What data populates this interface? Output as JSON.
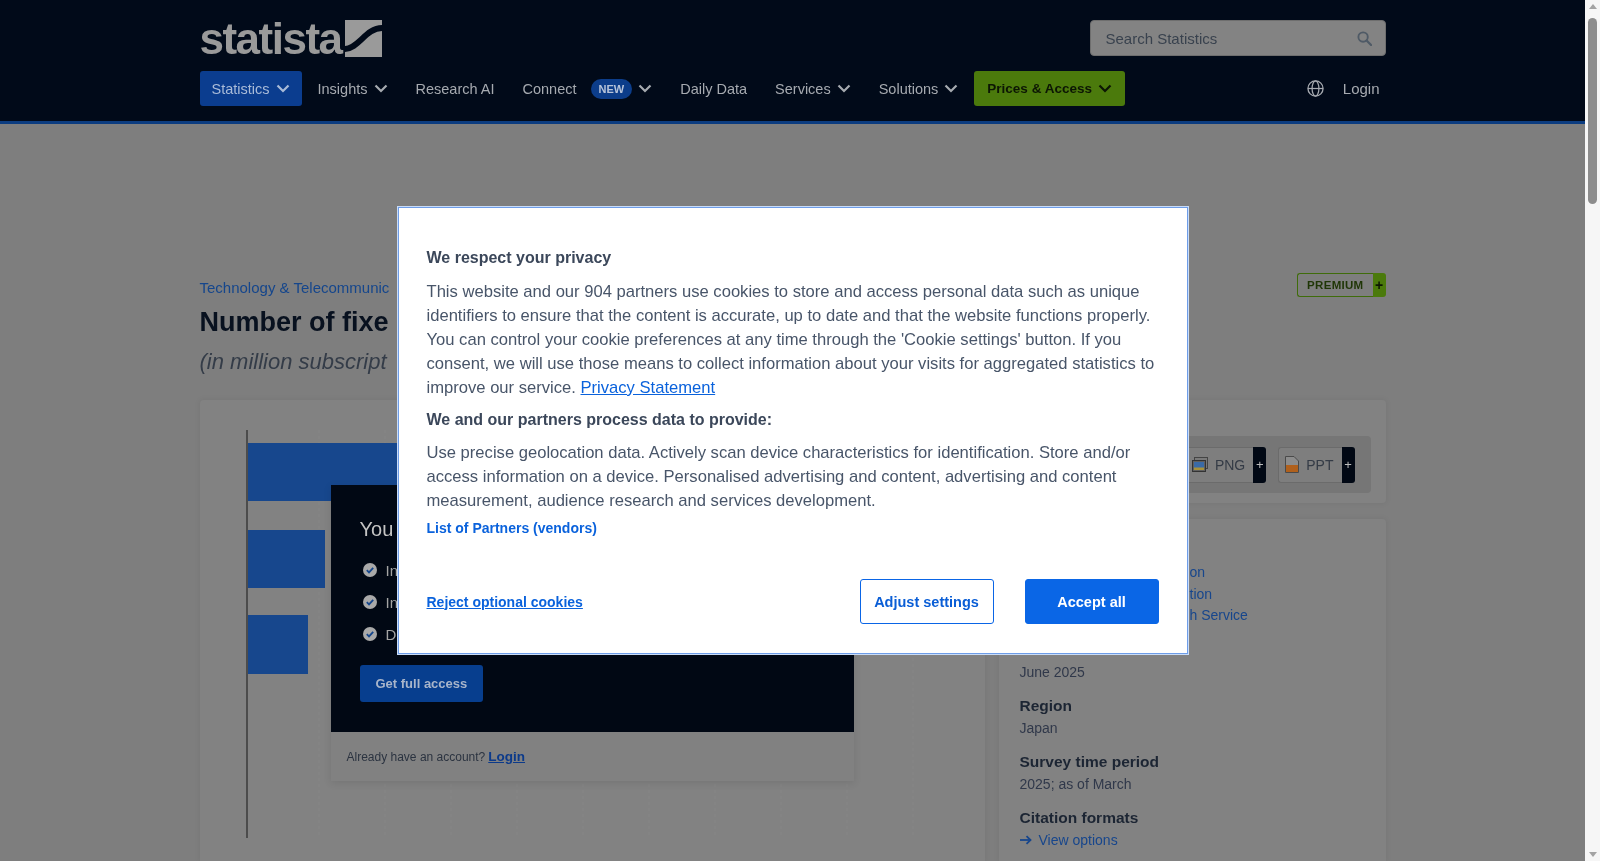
{
  "header": {
    "logo": "statista",
    "search": {
      "placeholder": "Search Statistics"
    },
    "nav": [
      {
        "label": "Statistics",
        "kind": "menu",
        "selected": true,
        "dropdown": true
      },
      {
        "label": "Insights",
        "kind": "menu",
        "selected": false,
        "dropdown": true
      },
      {
        "label": "Research AI",
        "kind": "menu",
        "selected": false,
        "dropdown": false
      },
      {
        "label": "Connect",
        "kind": "menu",
        "selected": false,
        "dropdown": true,
        "badge": "NEW"
      },
      {
        "label": "Daily Data",
        "kind": "menu",
        "selected": false,
        "dropdown": false
      },
      {
        "label": "Services",
        "kind": "menu",
        "selected": false,
        "dropdown": true
      },
      {
        "label": "Solutions",
        "kind": "menu",
        "selected": false,
        "dropdown": true
      },
      {
        "label": "Prices & Access",
        "kind": "cta",
        "selected": false,
        "dropdown": true
      }
    ],
    "login": "Login"
  },
  "statistic": {
    "breadcrumb": "Technology & Telecommunic",
    "title": "Number of fixe",
    "subtitle": "(in million subscript",
    "premium": {
      "label": "PREMIUM",
      "plus": "+"
    }
  },
  "paywall": {
    "heading": "You",
    "features": [
      "In",
      "In",
      "D"
    ],
    "button": "Get full access",
    "account_prompt": "Already have an account?",
    "login_link": "Login"
  },
  "downloads": [
    {
      "label": "PNG",
      "kind": "image",
      "plus": "+"
    },
    {
      "label": "PPT",
      "kind": "slides",
      "plus": "+"
    }
  ],
  "details": {
    "links": [
      "on",
      "tion",
      "h Service"
    ],
    "items": [
      {
        "value": "June 2025"
      },
      {
        "label": "Region",
        "value": "Japan"
      },
      {
        "label": "Survey time period",
        "value": "2025; as of March"
      },
      {
        "label": "Citation formats",
        "link": "View options"
      }
    ]
  },
  "consent_dialog": {
    "title": "We respect your privacy",
    "text": "This website and our 904 partners use cookies to store and access personal data such as unique identifiers to ensure that the content is accurate, up to date and that the website functions properly. You can control your cookie preferences at any time through the 'Cookie settings' button. If you consent, we will use those means to collect information about your visits for aggregated statistics to improve our service.",
    "privacy_link": "Privacy Statement",
    "purposes_title": "We and our partners process data to provide:",
    "purposes_text": "Use precise geolocation data. Actively scan device characteristics for identification. Store and/or access information on a device. Personalised advertising and content, advertising and content measurement, audience research and services development.",
    "partners_link": "List of Partners (vendors)",
    "reject": "Reject optional cookies",
    "buttons": [
      {
        "label": "Adjust settings",
        "kind": "secondary"
      },
      {
        "label": "Accept all",
        "kind": "primary"
      }
    ]
  }
}
